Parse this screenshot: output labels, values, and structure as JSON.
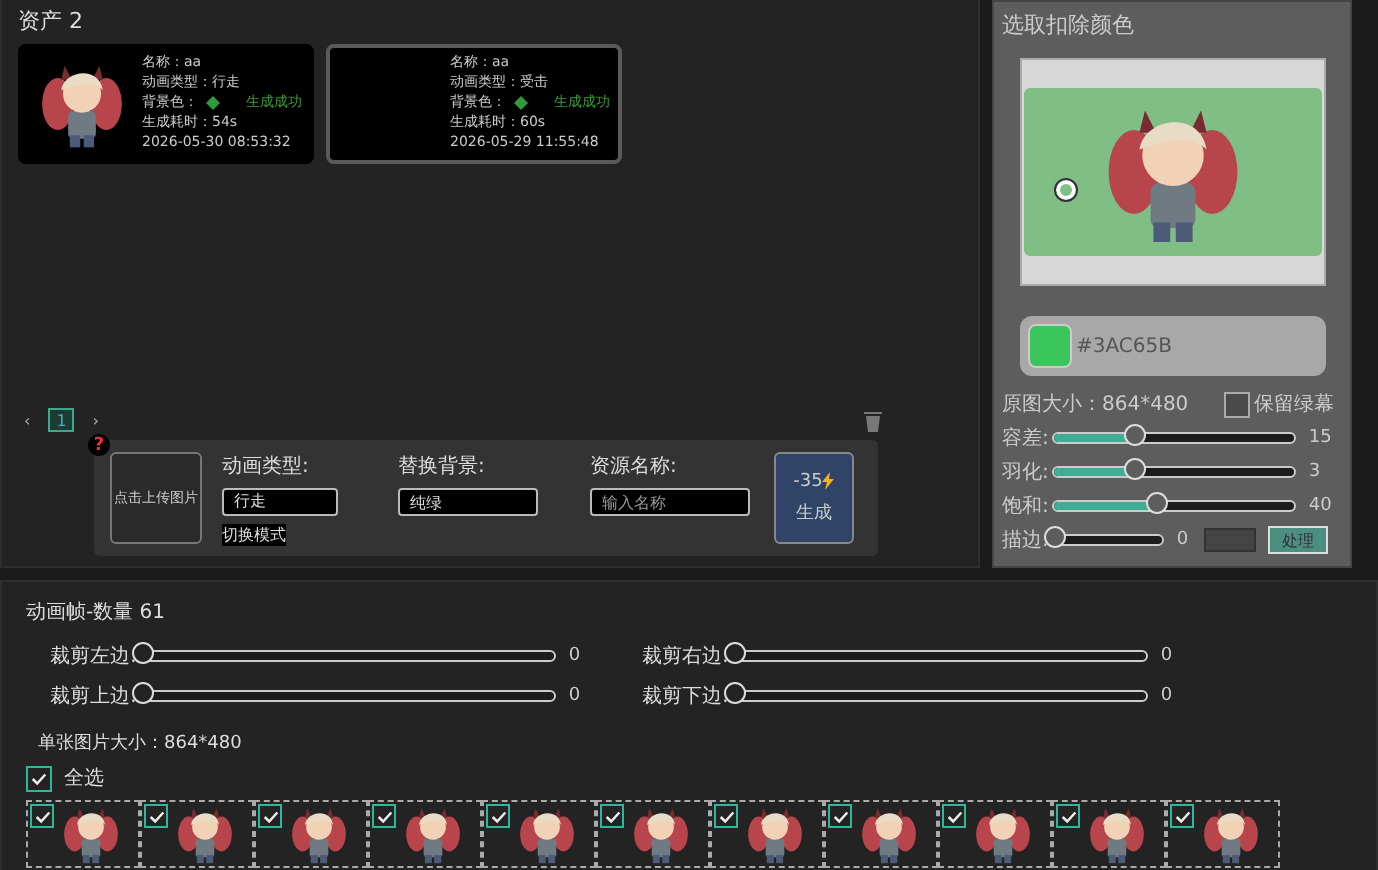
{
  "assets": {
    "title": "资产 2",
    "items": [
      {
        "has_image": true,
        "selected": false,
        "name": "名称：aa",
        "type": "动画类型：行走",
        "bg_label": "背景色：",
        "color": "#2e9a3a",
        "status": "生成成功",
        "duration": "生成耗时：54s",
        "time": "2026-05-30 08:53:32"
      },
      {
        "has_image": false,
        "selected": true,
        "name": "名称：aa",
        "type": "动画类型：受击",
        "bg_label": "背景色：",
        "color": "#2e9a3a",
        "status": "生成成功",
        "duration": "生成耗时：60s",
        "time": "2026-05-29 11:55:48"
      }
    ]
  },
  "pagination": {
    "prev": "‹",
    "pages": [
      {
        "label": "1",
        "selected": true
      }
    ],
    "next": "›"
  },
  "form": {
    "help": "?",
    "upload": "点击上传图片",
    "fields": [
      {
        "label": "动画类型:",
        "value": "行走"
      },
      {
        "label": "替换背景:",
        "value": "纯绿"
      },
      {
        "label": "资源名称:",
        "placeholder": "输入名称"
      }
    ],
    "switch_mode": "切换模式",
    "cost": "-35",
    "generate": "生成"
  },
  "color_panel": {
    "title": "选取扣除颜色",
    "color": "#3AC65B",
    "color_text": "#3AC65B",
    "size": "原图大小：864*480",
    "keep_green": {
      "label": "保留绿幕",
      "checked": false
    },
    "sliders": [
      {
        "label": "容差:",
        "level": 0.33,
        "reading": "15"
      },
      {
        "label": "羽化:",
        "level": 0.33,
        "reading": "3"
      },
      {
        "label": "饱和:",
        "level": 0.42,
        "reading": "40"
      }
    ],
    "stroke": {
      "label": "描边:",
      "level": 0,
      "reading": "0"
    },
    "process": "处理"
  },
  "frames": {
    "title": "动画帧-数量 61",
    "crops": [
      {
        "label": "裁剪左边:",
        "level": 0,
        "reading": "0"
      },
      {
        "label": "裁剪右边:",
        "level": 0,
        "reading": "0"
      },
      {
        "label": "裁剪上边:",
        "level": 0,
        "reading": "0"
      },
      {
        "label": "裁剪下边:",
        "level": 0,
        "reading": "0"
      }
    ],
    "size": "单张图片大小：864*480",
    "select_all": {
      "label": "全选",
      "checked": true
    },
    "items": [
      {
        "checked": true
      },
      {
        "checked": true
      },
      {
        "checked": true
      },
      {
        "checked": true
      },
      {
        "checked": true
      },
      {
        "checked": true
      },
      {
        "checked": true
      },
      {
        "checked": true
      },
      {
        "checked": true
      },
      {
        "checked": true
      },
      {
        "checked": true
      }
    ]
  }
}
